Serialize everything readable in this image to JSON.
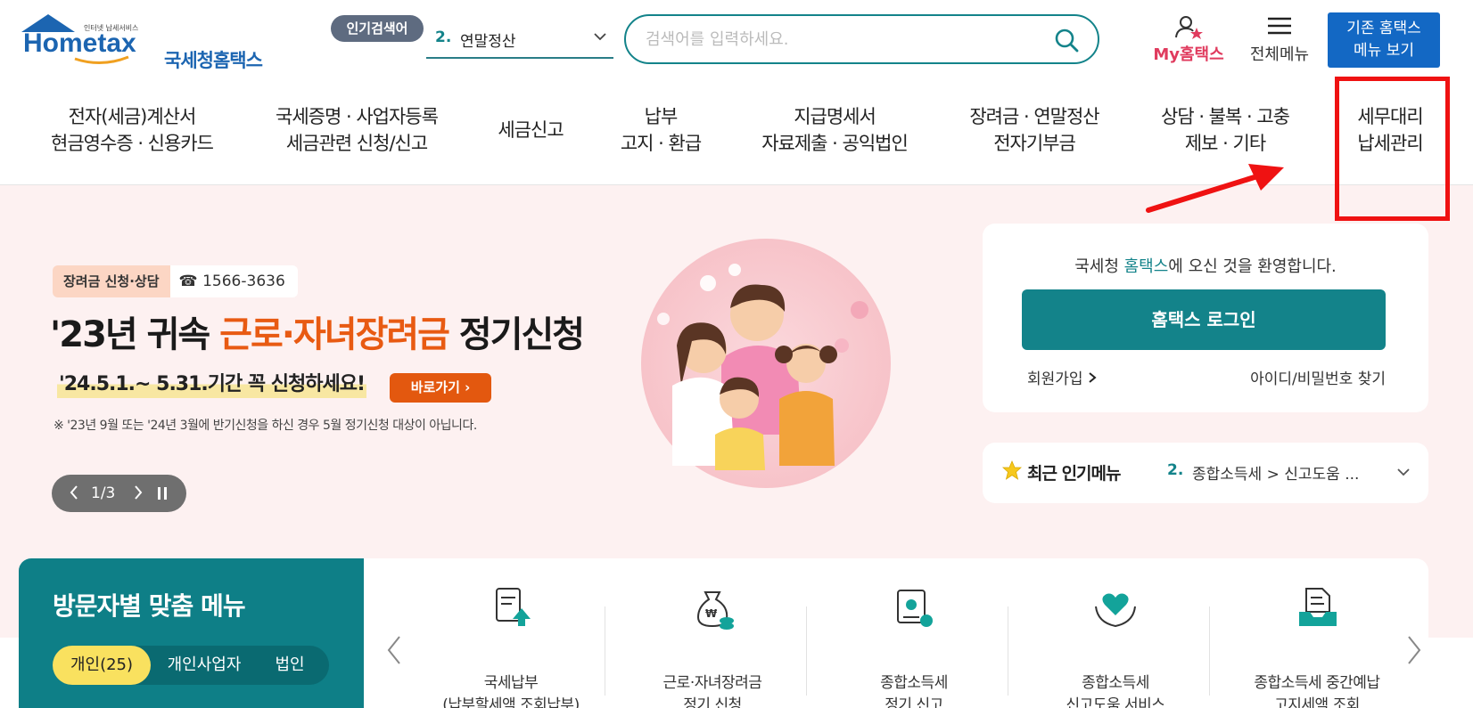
{
  "header": {
    "logo_tagline": "인터넷 납세서비스",
    "logo_main": "Hometax",
    "logo_name": "국세청홈택스",
    "popular_badge": "인기검색어",
    "popular_rank": "2.",
    "popular_keyword": "연말정산",
    "search_placeholder": "검색어를 입력하세요.",
    "my_hometax": "My홈택스",
    "all_menu": "전체메뉴",
    "old_menu_line1": "기존 홈택스",
    "old_menu_line2": "메뉴 보기"
  },
  "gnb": [
    {
      "line1": "전자(세금)계산서",
      "line2": "현금영수증 · 신용카드"
    },
    {
      "line1": "국세증명 · 사업자등록",
      "line2": "세금관련 신청/신고"
    },
    {
      "line1": "세금신고",
      "line2": ""
    },
    {
      "line1": "납부",
      "line2": "고지 · 환급"
    },
    {
      "line1": "지급명세서",
      "line2": "자료제출 · 공익법인"
    },
    {
      "line1": "장려금 · 연말정산",
      "line2": "전자기부금"
    },
    {
      "line1": "상담 · 불복 · 고충",
      "line2": "제보 · 기타"
    },
    {
      "line1": "세무대리",
      "line2": "납세관리"
    }
  ],
  "hero": {
    "chip_label": "장려금 신청·상담",
    "chip_phone": "☎ 1566-3636",
    "title_pre": "'23년 귀속 ",
    "title_highlight": "근로·자녀장려금",
    "title_post": " 정기신청",
    "subtitle": "'24.5.1.~ 5.31.기간 꼭 신청하세요!",
    "go_button": "바로가기 ›",
    "note": "※ '23년 9월 또는 '24년 3월에 반기신청을 하신 경우 5월 정기신청 대상이 아닙니다.",
    "pager": "1/3"
  },
  "login": {
    "welcome_pre": "국세청 ",
    "welcome_brand": "홈택스",
    "welcome_post": "에 오신 것을 환영합니다.",
    "login_button": "홈택스 로그인",
    "join": "회원가입",
    "find": "아이디/비밀번호 찾기"
  },
  "recent": {
    "title": "최근 인기메뉴",
    "rank": "2.",
    "value": "종합소득세 > 신고도움 ..."
  },
  "visitor": {
    "title": "방문자별 맞춤 메뉴",
    "tabs": [
      "개인(25)",
      "개인사업자",
      "법인"
    ]
  },
  "quick_menu": [
    {
      "line1": "국세납부",
      "line2": "(납부할세액 조회납부)",
      "icon": "document-upload-icon"
    },
    {
      "line1": "근로·자녀장려금",
      "line2": "정기 신청",
      "icon": "money-bag-icon"
    },
    {
      "line1": "종합소득세",
      "line2": "정기 신고",
      "icon": "certificate-icon"
    },
    {
      "line1": "종합소득세",
      "line2": "신고도움 서비스",
      "icon": "heart-hands-icon"
    },
    {
      "line1": "종합소득세 중간예납",
      "line2": "고지세액 조회",
      "icon": "file-tray-icon"
    }
  ],
  "colors": {
    "teal": "#13838a",
    "blue": "#1368c4",
    "orange": "#e3580f",
    "highlight_red": "#ef1212",
    "hero_bg": "#fdf1f1"
  }
}
